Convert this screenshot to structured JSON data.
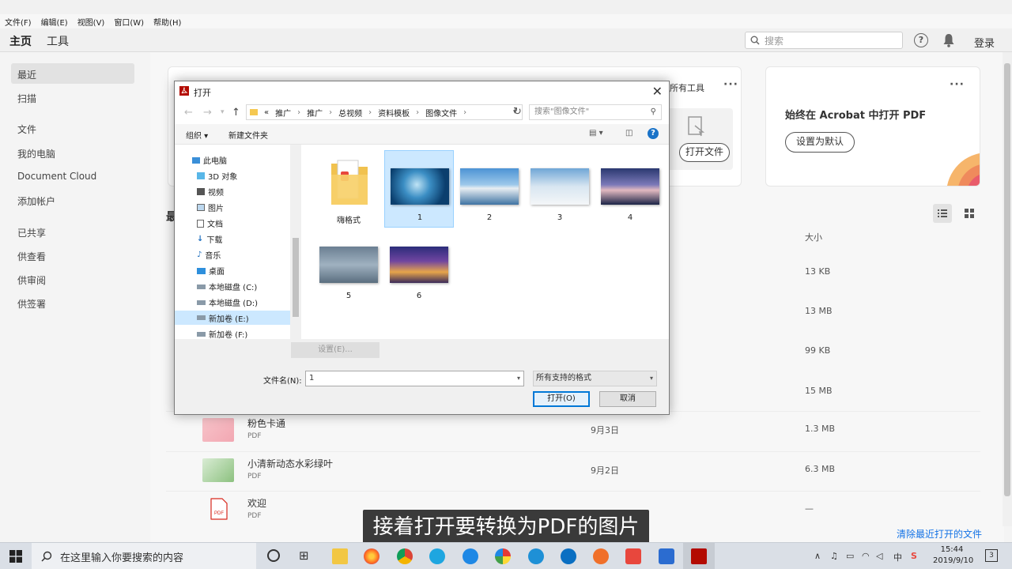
{
  "menubar": [
    "文件(F)",
    "编辑(E)",
    "视图(V)",
    "窗口(W)",
    "帮助(H)"
  ],
  "topbar": {
    "tab_home": "主页",
    "tab_tools": "工具",
    "search_placeholder": "搜索",
    "login": "登录",
    "help_glyph": "?"
  },
  "sidebar": {
    "items": [
      "最近",
      "扫描",
      "文件",
      "我的电脑",
      "Document Cloud",
      "添加帐户",
      "已共享",
      "供查看",
      "供审阅",
      "供签署"
    ]
  },
  "cards": {
    "tools_title": "所有工具",
    "open_file_btn": "打开文件",
    "default_title": "始终在 Acrobat 中打开 PDF",
    "set_default_btn": "设置为默认",
    "dots": "···"
  },
  "list": {
    "recent_heading_frag": "最",
    "size_header": "大小",
    "hidden_sizes": [
      "13 KB",
      "13 MB",
      "99 KB",
      "15 MB"
    ],
    "rows": [
      {
        "name": "粉色卡通",
        "type": "PDF",
        "date": "9月3日",
        "size": "1.3 MB"
      },
      {
        "name": "小清新动态水彩绿叶",
        "type": "PDF",
        "date": "9月2日",
        "size": "6.3 MB"
      },
      {
        "name": "欢迎",
        "type": "PDF",
        "date": "",
        "size": "—"
      }
    ],
    "clear_link": "清除最近打开的文件"
  },
  "subtitle": "接着打开要转换为PDF的图片",
  "dialog": {
    "title": "打开",
    "close_glyph": "✕",
    "breadcrumb": [
      "«",
      "推广",
      "推广",
      "总视频",
      "资料模板",
      "图像文件"
    ],
    "search_placeholder": "搜索\"图像文件\"",
    "organize": "组织 ▾",
    "new_folder": "新建文件夹",
    "tree": [
      "此电脑",
      "3D 对象",
      "视频",
      "图片",
      "文档",
      "下载",
      "音乐",
      "桌面",
      "本地磁盘 (C:)",
      "本地磁盘 (D:)",
      "新加卷 (E:)",
      "新加卷 (F:)"
    ],
    "tree_selected": "新加卷 (E:)",
    "files": [
      "嗨格式",
      "1",
      "2",
      "3",
      "4",
      "5",
      "6"
    ],
    "selected_file": "1",
    "settings_btn": "设置(E)...",
    "filename_label": "文件名(N):",
    "filename_value": "1",
    "filetype_value": "所有支持的格式",
    "open_btn": "打开(O)",
    "cancel_btn": "取消"
  },
  "taskbar": {
    "search_text": "在这里输入你要搜索的内容",
    "ime": "中",
    "time": "15:44",
    "date": "2019/9/10",
    "notif_count": "3"
  }
}
